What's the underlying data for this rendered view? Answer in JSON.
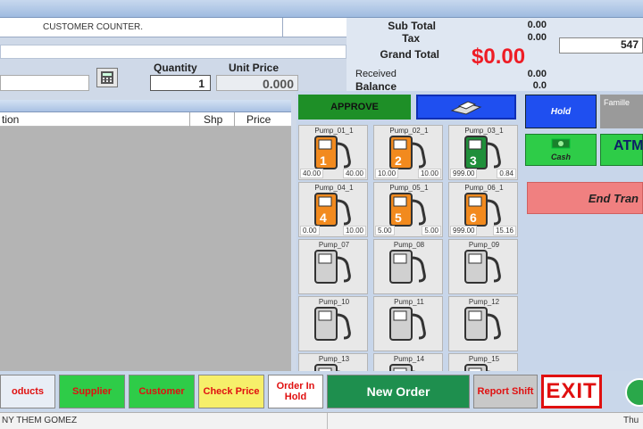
{
  "customer": {
    "name": "CUSTOMER COUNTER."
  },
  "entry": {
    "quantity_label": "Quantity",
    "unit_price_label": "Unit Price",
    "quantity": "1",
    "unit_price": "0.000"
  },
  "totals": {
    "subtotal_label": "Sub Total",
    "subtotal": "0.00",
    "tax_label": "Tax",
    "tax": "0.00",
    "grand_total_label": "Grand Total",
    "grand_total": "$0.00",
    "received_label": "Received",
    "received": "0.00",
    "balance_label": "Balance",
    "balance": "0.0",
    "cash_input": "547"
  },
  "grid": {
    "columns": [
      "tion",
      "Shp",
      "Price"
    ]
  },
  "pumps_panel": {
    "approve_label": "APPROVE"
  },
  "pumps": [
    {
      "name": "Pump_01_1",
      "number": "1",
      "color": "#f28a1e",
      "v1": "40.00",
      "v2": "40.00"
    },
    {
      "name": "Pump_02_1",
      "number": "2",
      "color": "#f28a1e",
      "v1": "10.00",
      "v2": "10.00"
    },
    {
      "name": "Pump_03_1",
      "number": "3",
      "color": "#1f8f3a",
      "v1": "999.00",
      "v2": "0.84"
    },
    {
      "name": "Pump_04_1",
      "number": "4",
      "color": "#f28a1e",
      "v1": "0.00",
      "v2": "10.00"
    },
    {
      "name": "Pump_05_1",
      "number": "5",
      "color": "#f28a1e",
      "v1": "5.00",
      "v2": "5.00"
    },
    {
      "name": "Pump_06_1",
      "number": "6",
      "color": "#f28a1e",
      "v1": "999.00",
      "v2": "15.16"
    },
    {
      "name": "Pump_07",
      "number": "",
      "color": "#d8d8d8"
    },
    {
      "name": "Pump_08",
      "number": "",
      "color": "#d8d8d8"
    },
    {
      "name": "Pump_09",
      "number": "",
      "color": "#d8d8d8"
    },
    {
      "name": "Pump_10",
      "number": "",
      "color": "#d8d8d8"
    },
    {
      "name": "Pump_11",
      "number": "",
      "color": "#d8d8d8"
    },
    {
      "name": "Pump_12",
      "number": "",
      "color": "#d8d8d8"
    },
    {
      "name": "Pump_13",
      "number": "",
      "color": "#d8d8d8"
    },
    {
      "name": "Pump_14",
      "number": "",
      "color": "#d8d8d8"
    },
    {
      "name": "Pump_15",
      "number": "",
      "color": "#d8d8d8"
    }
  ],
  "right": {
    "hold": "Hold",
    "famille": "Famille",
    "cash": "Cash",
    "atm": "ATM",
    "end_transaction": "End Tran"
  },
  "bottom": {
    "products": "oducts",
    "supplier": "Supplier",
    "customer": "Customer",
    "check_price": "Check Price",
    "order_in_hold": "Order In Hold",
    "new_order": "New Order",
    "report_shift": "Report Shift",
    "exit": "EXIT"
  },
  "status": {
    "user": "NY THEM GOMEZ",
    "day": "Thu"
  },
  "colors": {
    "grand_total": "#ee1c25",
    "approve": "#1e8f27",
    "new_order": "#1e8f4e",
    "exit": "#e01010"
  }
}
